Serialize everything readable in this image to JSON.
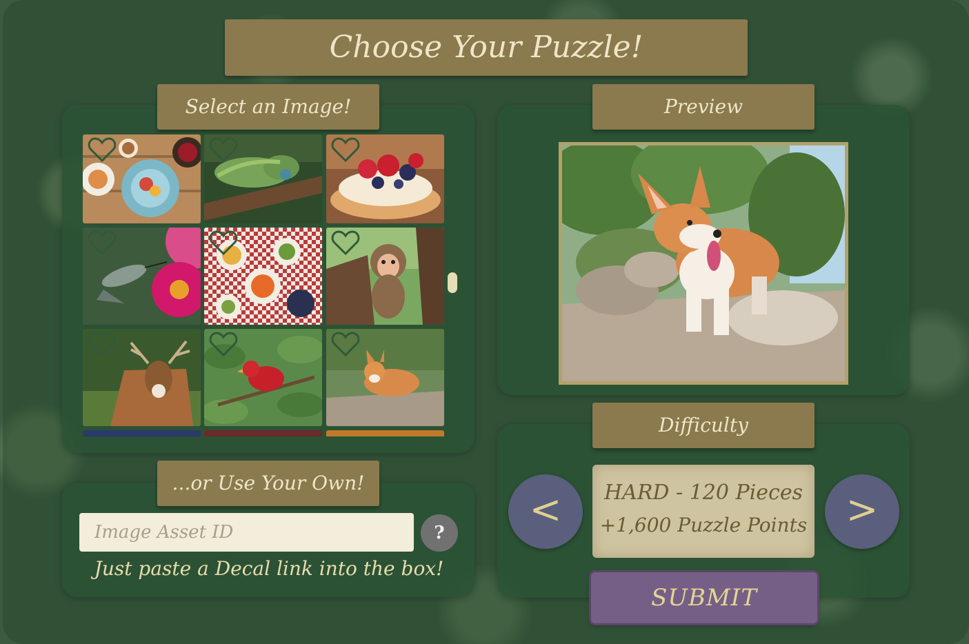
{
  "title": "Choose Your Puzzle!",
  "select_section": {
    "title": "Select an Image!"
  },
  "preview_section": {
    "title": "Preview"
  },
  "own_section": {
    "title": "...or Use Your Own!",
    "input_placeholder": "Image Asset ID",
    "input_value": "",
    "help_label": "?",
    "hint": "Just paste a Decal link into the box!"
  },
  "difficulty_section": {
    "title": "Difficulty",
    "level": "HARD - 120 Pieces",
    "points": "+1,600 Puzzle Points",
    "prev_label": "<",
    "next_label": ">"
  },
  "submit_label": "SUBMIT",
  "images": [
    {
      "subject": "breakfast-table"
    },
    {
      "subject": "iguana"
    },
    {
      "subject": "berry-tart"
    },
    {
      "subject": "hummingbird"
    },
    {
      "subject": "picnic-spread"
    },
    {
      "subject": "monkey"
    },
    {
      "subject": "deer"
    },
    {
      "subject": "cardinal"
    },
    {
      "subject": "corgi"
    }
  ],
  "colors": {
    "banner": "#8a7a4e",
    "panel": "#2a5234",
    "submit": "#765f86",
    "arrow": "#5a5f7d",
    "difficulty_box": "#cfc4a1"
  }
}
